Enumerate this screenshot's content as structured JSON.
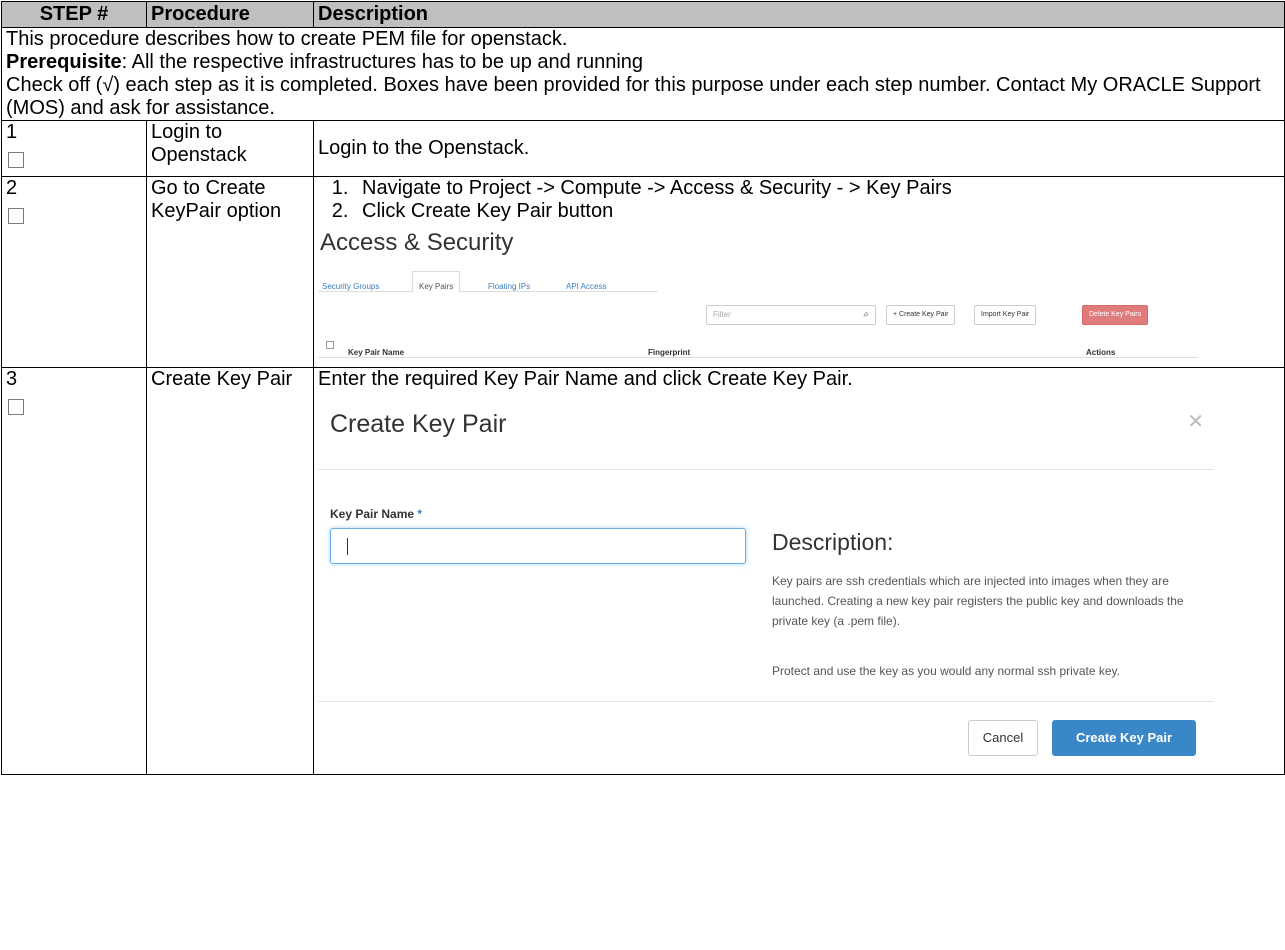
{
  "header": {
    "step": "STEP #",
    "procedure": "Procedure",
    "description": "Description"
  },
  "intro": {
    "line1": "This procedure describes how to create PEM file for openstack.",
    "prereq_label": "Prerequisite",
    "prereq_text": ": All the respective infrastructures has to be up and running",
    "check_text": "Check off (√) each step as it is completed.  Boxes have been provided for this purpose under each step number. Contact My ORACLE Support (MOS) and ask for assistance."
  },
  "steps": [
    {
      "number": "1",
      "procedure": "Login to Openstack",
      "description": "Login to the Openstack."
    },
    {
      "number": "2",
      "procedure": "Go to Create KeyPair option",
      "items": [
        "Navigate to Project -> Compute -> Access & Security - > Key Pairs",
        "Click Create Key Pair button"
      ]
    },
    {
      "number": "3",
      "procedure": "Create Key Pair",
      "description": "Enter the required Key Pair Name and click Create Key Pair."
    }
  ],
  "access_security": {
    "title": "Access & Security",
    "tabs": [
      "Security Groups",
      "Key Pairs",
      "Floating IPs",
      "API Access"
    ],
    "filter_placeholder": "Filter",
    "buttons": [
      "+ Create Key Pair",
      "Import Key Pair",
      "Delete Key Pairs"
    ],
    "columns": [
      "Key Pair Name",
      "Fingerprint",
      "Actions"
    ]
  },
  "modal": {
    "title": "Create Key Pair",
    "field_label": "Key Pair Name",
    "required_mark": "*",
    "desc_title": "Description:",
    "desc_p1": "Key pairs are ssh credentials which are injected into images when they are launched. Creating a new key pair registers the public key and downloads the private key (a .pem file).",
    "desc_p2": "Protect and use the key as you would any normal ssh private key.",
    "cancel_label": "Cancel",
    "create_label": "Create Key Pair"
  }
}
